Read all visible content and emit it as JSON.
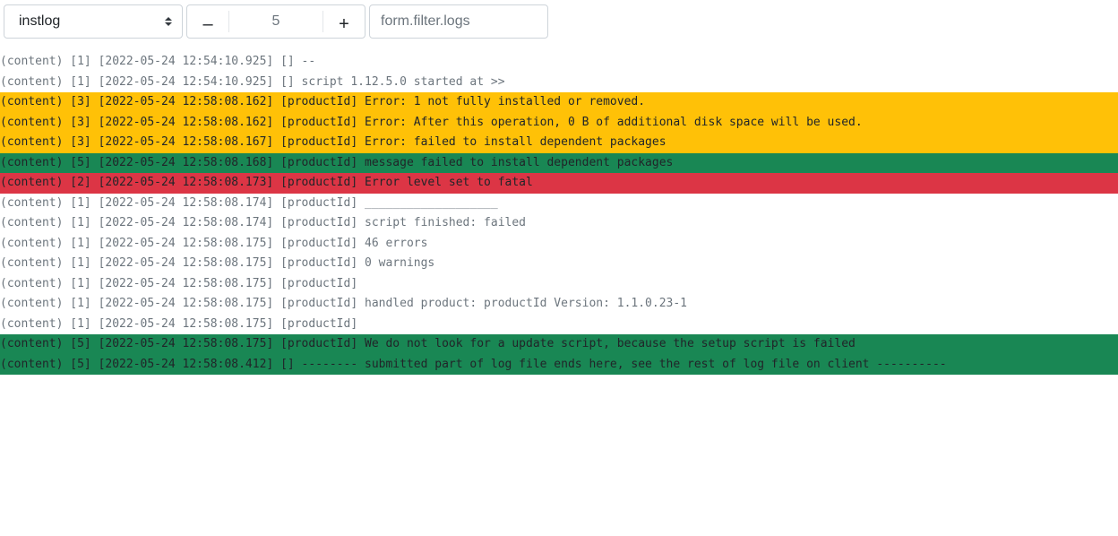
{
  "toolbar": {
    "log_select": {
      "value": "instlog"
    },
    "stepper": {
      "decrement_label": "–",
      "value": "5",
      "increment_label": "+"
    },
    "filter": {
      "placeholder": "form.filter.logs",
      "value": ""
    }
  },
  "colors": {
    "level_3": "#ffc107",
    "level_5": "#198754",
    "level_2": "#dc3545",
    "level_1_text": "#6c757d"
  },
  "log_lines": [
    {
      "level": 1,
      "text": "(content) [1] [2022-05-24 12:54:10.925] [] --"
    },
    {
      "level": 1,
      "text": "(content) [1] [2022-05-24 12:54:10.925] [] script 1.12.5.0 started at >>"
    },
    {
      "level": 3,
      "text": "(content) [3] [2022-05-24 12:58:08.162] [productId] Error: 1 not fully installed or removed."
    },
    {
      "level": 3,
      "text": "(content) [3] [2022-05-24 12:58:08.162] [productId] Error: After this operation, 0 B of additional disk space will be used."
    },
    {
      "level": 3,
      "text": "(content) [3] [2022-05-24 12:58:08.167] [productId] Error: failed to install dependent packages"
    },
    {
      "level": 5,
      "text": "(content) [5] [2022-05-24 12:58:08.168] [productId] message failed to install dependent packages"
    },
    {
      "level": 2,
      "text": "(content) [2] [2022-05-24 12:58:08.173] [productId] Error level set to fatal"
    },
    {
      "level": 1,
      "text": "(content) [1] [2022-05-24 12:58:08.174] [productId] ___________________"
    },
    {
      "level": 1,
      "text": "(content) [1] [2022-05-24 12:58:08.174] [productId] script finished: failed"
    },
    {
      "level": 1,
      "text": "(content) [1] [2022-05-24 12:58:08.175] [productId] 46 errors"
    },
    {
      "level": 1,
      "text": "(content) [1] [2022-05-24 12:58:08.175] [productId] 0 warnings"
    },
    {
      "level": 1,
      "text": "(content) [1] [2022-05-24 12:58:08.175] [productId]"
    },
    {
      "level": 1,
      "text": "(content) [1] [2022-05-24 12:58:08.175] [productId] handled product: productId Version: 1.1.0.23-1"
    },
    {
      "level": 1,
      "text": "(content) [1] [2022-05-24 12:58:08.175] [productId]"
    },
    {
      "level": 5,
      "text": "(content) [5] [2022-05-24 12:58:08.175] [productId] We do not look for a update script, because the setup script is failed"
    },
    {
      "level": 5,
      "text": "(content) [5] [2022-05-24 12:58:08.412] [] -------- submitted part of log file ends here, see the rest of log file on client ----------"
    }
  ]
}
